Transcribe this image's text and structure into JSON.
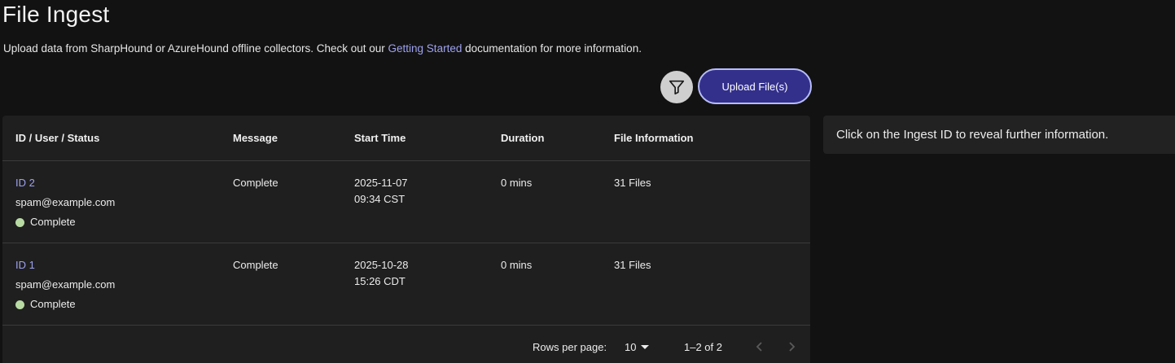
{
  "page": {
    "title": "File Ingest",
    "subtitle_before": "Upload data from SharpHound or AzureHound offline collectors. Check out our ",
    "subtitle_link": "Getting Started",
    "subtitle_after": " documentation for more information."
  },
  "toolbar": {
    "filter_icon": "filter-icon",
    "upload_label": "Upload File(s)"
  },
  "table": {
    "columns": [
      "ID / User / Status",
      "Message",
      "Start Time",
      "Duration",
      "File Information"
    ],
    "rows": [
      {
        "id": "ID 2",
        "user": "spam@example.com",
        "status": "Complete",
        "message": "Complete",
        "start_date": "2025-11-07",
        "start_time": "09:34 CST",
        "duration": "0 mins",
        "files": "31 Files"
      },
      {
        "id": "ID 1",
        "user": "spam@example.com",
        "status": "Complete",
        "message": "Complete",
        "start_date": "2025-10-28",
        "start_time": "15:26 CDT",
        "duration": "0 mins",
        "files": "31 Files"
      }
    ]
  },
  "pagination": {
    "rows_per_page_label": "Rows per page:",
    "rows_per_page_value": "10",
    "range": "1–2 of 2"
  },
  "info_panel": {
    "text": "Click on the Ingest ID to reveal further information."
  },
  "colors": {
    "accent_link": "#9ea2f0",
    "upload_bg": "#33308c",
    "status_complete": "#b8dba4"
  }
}
